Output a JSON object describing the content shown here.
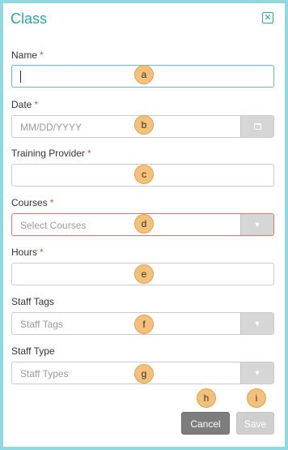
{
  "dialog": {
    "title": "Class",
    "close_symbol": "✕"
  },
  "fields": {
    "name": {
      "label": "Name",
      "required_mark": "*",
      "value": ""
    },
    "date": {
      "label": "Date",
      "required_mark": "*",
      "placeholder": "MM/DD/YYYY",
      "addon_icon": "calendar-icon"
    },
    "training_provider": {
      "label": "Training Provider",
      "required_mark": "*",
      "value": ""
    },
    "courses": {
      "label": "Courses",
      "required_mark": "*",
      "placeholder": "Select Courses",
      "addon_icon": "chevron-down-icon"
    },
    "hours": {
      "label": "Hours",
      "required_mark": "*",
      "value": ""
    },
    "staff_tags": {
      "label": "Staff Tags",
      "placeholder": "Staff Tags",
      "addon_icon": "chevron-down-icon"
    },
    "staff_type": {
      "label": "Staff Type",
      "placeholder": "Staff Types",
      "addon_icon": "chevron-down-icon"
    }
  },
  "markers": [
    "a",
    "b",
    "c",
    "d",
    "e",
    "f",
    "g",
    "h",
    "i"
  ],
  "buttons": {
    "cancel": "Cancel",
    "save": "Save"
  },
  "colors": {
    "accent": "#2aa6a8",
    "frame": "#8fd9df",
    "required": "#d9534f",
    "error_border": "#e57373",
    "marker": "#f5c07a"
  }
}
